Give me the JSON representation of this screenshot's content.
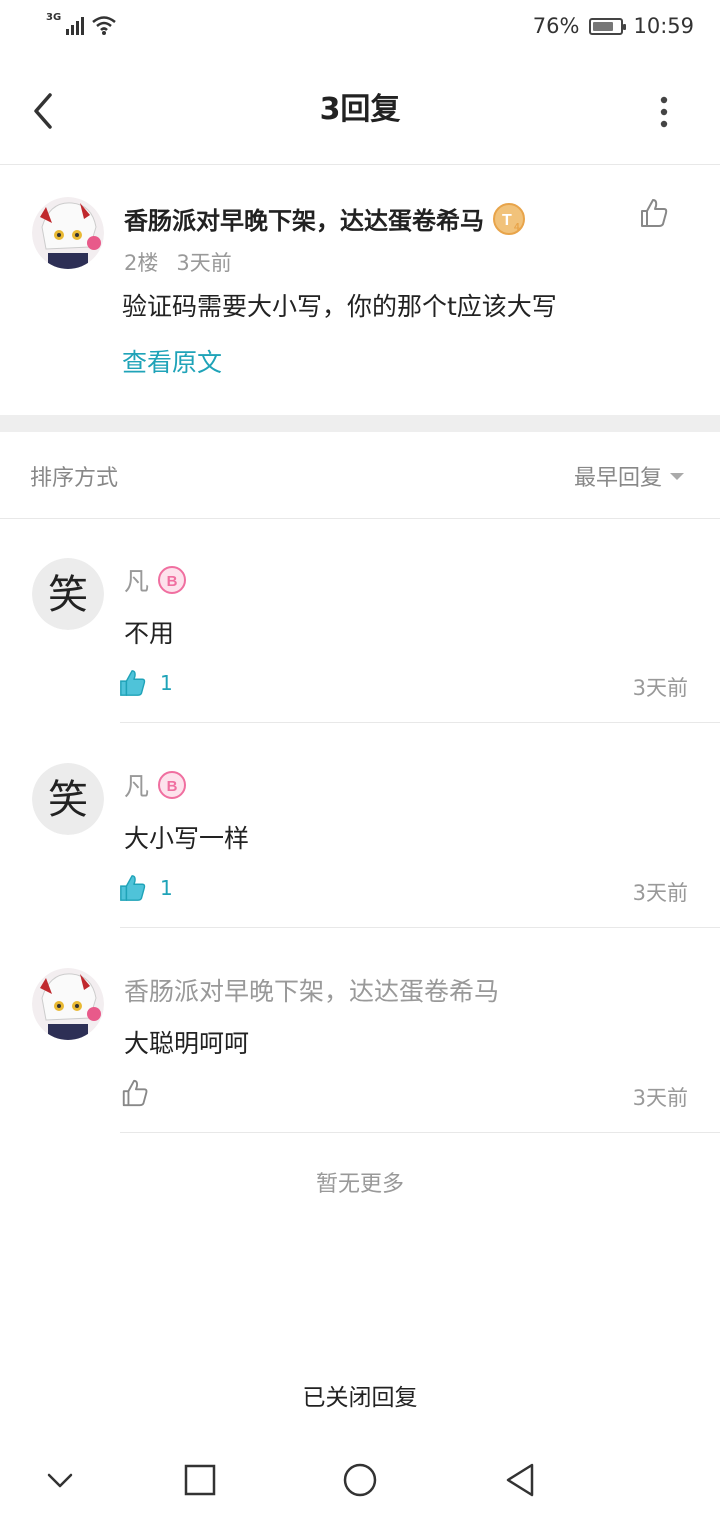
{
  "status_bar": {
    "network": "3G",
    "battery": "76%",
    "battery_level": 0.76,
    "time": "10:59"
  },
  "header": {
    "title": "3回复"
  },
  "original_post": {
    "username": "香肠派对早晚下架，达达蛋卷希马",
    "floor": "2楼",
    "time": "3天前",
    "content": "验证码需要大小写，你的那个t应该大写",
    "view_original": "查看原文"
  },
  "sort": {
    "label": "排序方式",
    "value": "最早回复"
  },
  "replies": [
    {
      "username": "凡",
      "content": "不用",
      "likes": "1",
      "time": "3天前"
    },
    {
      "username": "凡",
      "content": "大小写一样",
      "likes": "1",
      "time": "3天前"
    },
    {
      "username": "香肠派对早晚下架，达达蛋卷希马",
      "content": "大聪明呵呵",
      "likes": "",
      "time": "3天前"
    }
  ],
  "footer": {
    "no_more": "暂无更多",
    "closed": "已关闭回复"
  },
  "colors": {
    "accent": "#1fa3b8",
    "badge_pink": "#f06fa0",
    "badge_gold": "#e8a44a"
  },
  "icons": [
    "back-icon",
    "more-icon",
    "thumbs-up-icon",
    "level-badge-icon",
    "dropdown-arrow-icon",
    "nav-back-icon",
    "nav-home-icon",
    "nav-recents-icon",
    "nav-collapse-icon"
  ]
}
